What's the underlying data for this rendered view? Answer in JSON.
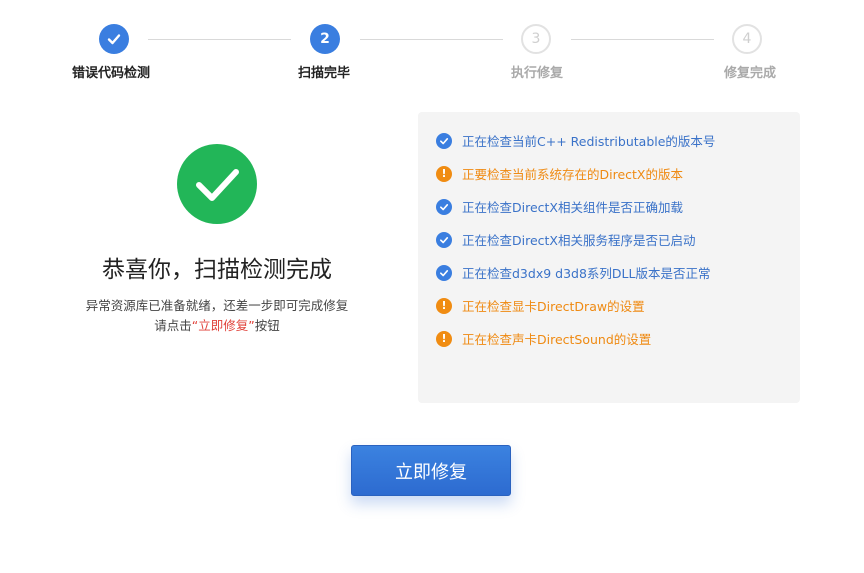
{
  "stepper": {
    "steps": [
      {
        "label": "错误代码检测",
        "number": "1",
        "state": "done"
      },
      {
        "label": "扫描完毕",
        "number": "2",
        "state": "active"
      },
      {
        "label": "执行修复",
        "number": "3",
        "state": "pending"
      },
      {
        "label": "修复完成",
        "number": "4",
        "state": "pending"
      }
    ]
  },
  "result": {
    "title": "恭喜你，扫描检测完成",
    "line1": "异常资源库已准备就绪，还差一步即可完成修复",
    "line2_prefix": "请点击",
    "line2_highlight": "“立即修复”",
    "line2_suffix": "按钮"
  },
  "checks": [
    {
      "status": "ok",
      "text": "正在检查当前C++ Redistributable的版本号"
    },
    {
      "status": "warn",
      "text": "正要检查当前系统存在的DirectX的版本"
    },
    {
      "status": "ok",
      "text": "正在检查DirectX相关组件是否正确加载"
    },
    {
      "status": "ok",
      "text": "正在检查DirectX相关服务程序是否已启动"
    },
    {
      "status": "ok",
      "text": "正在检查d3dx9 d3d8系列DLL版本是否正常"
    },
    {
      "status": "warn",
      "text": "正在检查显卡DirectDraw的设置"
    },
    {
      "status": "warn",
      "text": "正在检查声卡DirectSound的设置"
    }
  ],
  "fix_button": {
    "label": "立即修复"
  },
  "colors": {
    "primary": "#3a7ee0",
    "success": "#22b658",
    "warning": "#ef8a12",
    "highlight": "#e0423a"
  }
}
